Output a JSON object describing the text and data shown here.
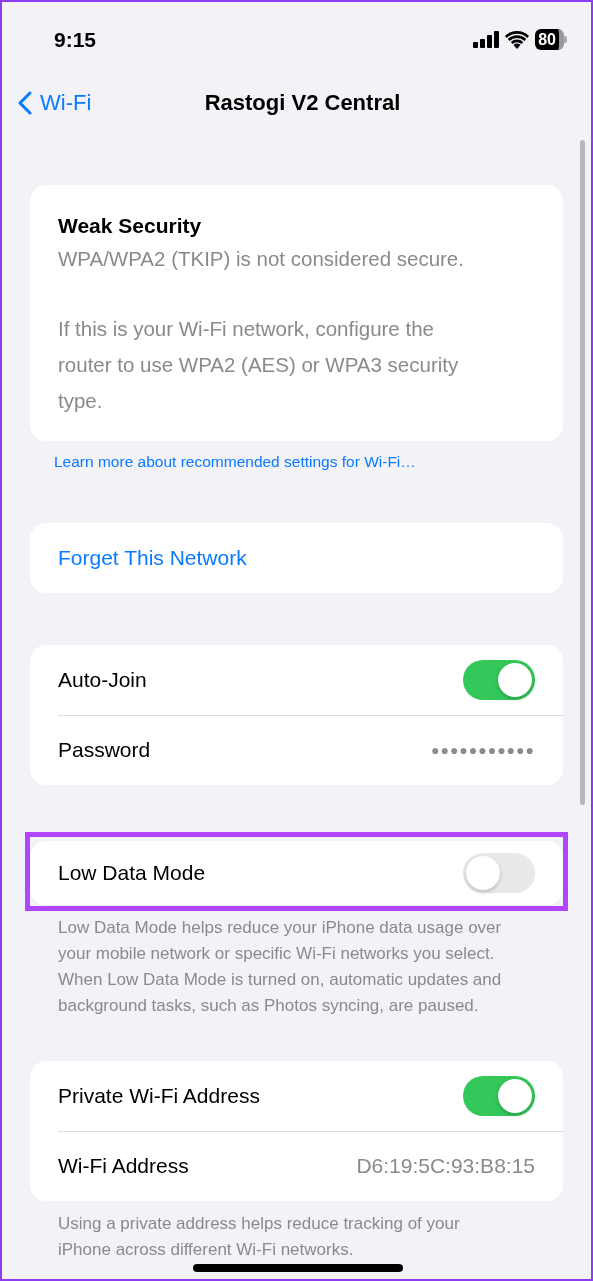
{
  "status_bar": {
    "time": "9:15",
    "battery": "80"
  },
  "nav": {
    "back": "Wi-Fi",
    "title": "Rastogi V2 Central"
  },
  "groups": [
    {
      "kind": "notice",
      "title": "Weak Security",
      "paragraphs": [
        "WPA/WPA2 (TKIP) is not considered secure.",
        "If this is your Wi-Fi network, configure the router to use WPA2 (AES) or WPA3 security type."
      ],
      "footer_link": "Learn more about recommended settings for Wi-Fi…"
    },
    {
      "kind": "rows",
      "highlighted": false,
      "rows": [
        {
          "kind": "action",
          "label": "Forget This Network"
        }
      ]
    },
    {
      "kind": "rows",
      "highlighted": false,
      "rows": [
        {
          "kind": "toggle",
          "label": "Auto-Join",
          "on": true
        },
        {
          "kind": "value",
          "label": "Password",
          "value": "●●●●●●●●●●●"
        }
      ]
    },
    {
      "kind": "rows",
      "highlighted": true,
      "rows": [
        {
          "kind": "toggle",
          "label": "Low Data Mode",
          "on": false
        }
      ],
      "footer": "Low Data Mode helps reduce your iPhone data usage over your mobile network or specific Wi-Fi networks you select. When Low Data Mode is turned on, automatic updates and background tasks, such as Photos syncing, are paused."
    },
    {
      "kind": "rows",
      "highlighted": false,
      "rows": [
        {
          "kind": "toggle",
          "label": "Private Wi-Fi Address",
          "on": true
        },
        {
          "kind": "value",
          "label": "Wi-Fi Address",
          "value": "D6:19:5C:93:B8:15"
        }
      ],
      "footer": "Using a private address helps reduce tracking of your iPhone across different Wi-Fi networks."
    }
  ]
}
